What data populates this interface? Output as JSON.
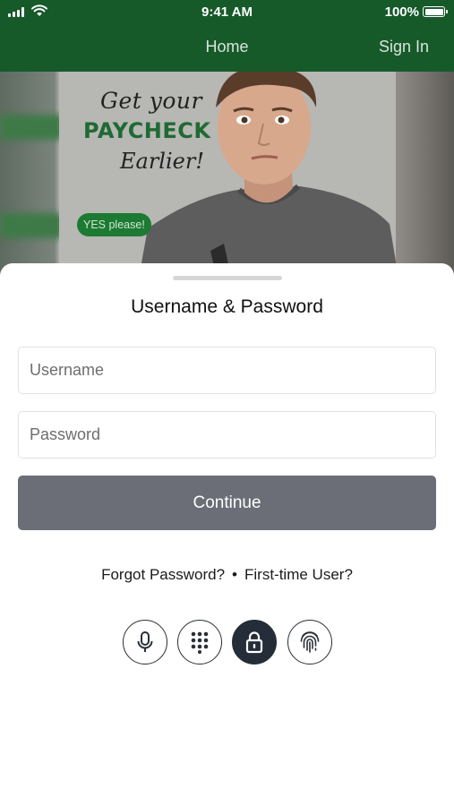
{
  "status_bar": {
    "time": "9:41 AM",
    "battery": "100%",
    "signal_icon": "cellular-signal-icon",
    "wifi_icon": "wifi-icon",
    "battery_icon": "battery-full-icon"
  },
  "header": {
    "title": "Home",
    "sign_in_label": "Sign In",
    "background_color": "#165a2a"
  },
  "banner": {
    "line1": "Get your",
    "line2": "PAYCHECK",
    "line3": "Earlier!",
    "cta": "YES please!",
    "accent_color": "#1f6a33"
  },
  "login_sheet": {
    "title": "Username & Password",
    "username": {
      "value": "",
      "placeholder": "Username"
    },
    "password": {
      "value": "",
      "placeholder": "Password"
    },
    "continue_label": "Continue",
    "continue_color": "#6b6e76",
    "forgot_password_label": "Forgot Password?",
    "separator": "•",
    "first_time_user_label": "First-time User?",
    "auth_methods": [
      {
        "icon": "microphone-icon",
        "active": false
      },
      {
        "icon": "keypad-icon",
        "active": false
      },
      {
        "icon": "lock-icon",
        "active": true
      },
      {
        "icon": "fingerprint-icon",
        "active": false
      }
    ]
  }
}
